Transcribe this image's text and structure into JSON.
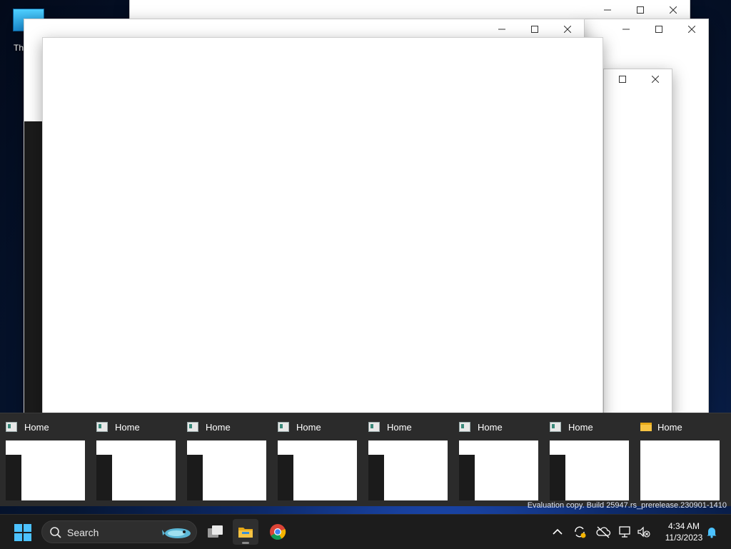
{
  "desktop": {
    "icon_label": "Th"
  },
  "flyout": {
    "thumbnails": [
      {
        "title": "Home",
        "icon": "app-window-icon"
      },
      {
        "title": "Home",
        "icon": "app-window-icon"
      },
      {
        "title": "Home",
        "icon": "app-window-icon"
      },
      {
        "title": "Home",
        "icon": "app-window-icon"
      },
      {
        "title": "Home",
        "icon": "app-window-icon"
      },
      {
        "title": "Home",
        "icon": "app-window-icon"
      },
      {
        "title": "Home",
        "icon": "app-window-icon"
      },
      {
        "title": "Home",
        "icon": "folder-icon"
      }
    ]
  },
  "watermark": "Evaluation copy. Build 25947.rs_prerelease.230901-1410",
  "taskbar": {
    "search_label": "Search",
    "time": "4:34 AM",
    "date": "11/3/2023",
    "accent": "#4cc2ff"
  }
}
